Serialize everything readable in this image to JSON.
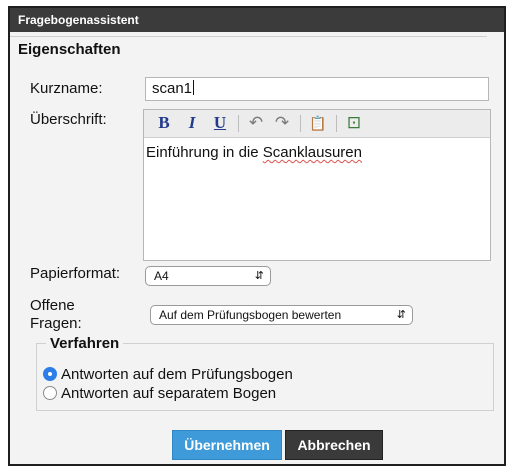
{
  "dialog": {
    "title": "Fragebogenassistent",
    "section_label": "Eigenschaften",
    "shortname": {
      "label": "Kurzname:",
      "value": "scan1"
    },
    "heading": {
      "label": "Überschrift:",
      "toolbar": [
        {
          "name": "bold",
          "glyph": "B"
        },
        {
          "name": "italic",
          "glyph": "I"
        },
        {
          "name": "underline",
          "glyph": "U"
        },
        {
          "name": "undo",
          "glyph": "↶"
        },
        {
          "name": "redo",
          "glyph": "↷"
        },
        {
          "name": "paste",
          "glyph": "📋"
        },
        {
          "name": "source",
          "glyph": "⊡"
        }
      ],
      "content_prefix": "Einführung in die ",
      "content_word": "Scanklausuren"
    },
    "paper_format": {
      "label": "Papierformat:",
      "value": "A4"
    },
    "open_questions": {
      "label_line1": "Offene",
      "label_line2": "Fragen:",
      "value": "Auf dem Prüfungsbogen bewerten"
    },
    "procedure": {
      "label": "Verfahren",
      "options": [
        {
          "label": "Antworten auf dem Prüfungsbogen",
          "selected": true
        },
        {
          "label": "Antworten auf separatem Bogen",
          "selected": false
        }
      ]
    },
    "buttons": {
      "apply": "Übernehmen",
      "cancel": "Abbrechen"
    }
  },
  "colors": {
    "titlebar": "#3b3b3b",
    "primary_button": "#3e9ad8",
    "secondary_button": "#3a3a3a",
    "radio_selected": "#2d7ee8"
  }
}
